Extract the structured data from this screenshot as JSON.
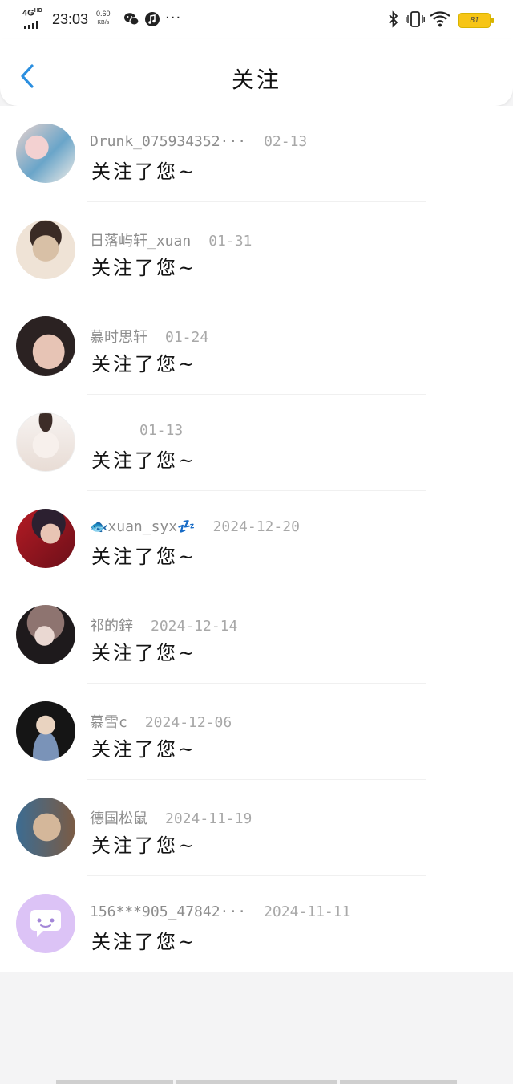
{
  "status_bar": {
    "network": "4G",
    "network_sub": "HD",
    "time": "23:03",
    "speed_value": "0.60",
    "speed_unit": "KB/s",
    "more": "···",
    "battery": "81"
  },
  "header": {
    "title": "关注"
  },
  "notifications": [
    {
      "username": "Drunk_075934352···",
      "date": "02-13",
      "text": "关注了您~",
      "avatar_colors": [
        "#f1d6d3",
        "#6aa5c9",
        "#f3eee8"
      ]
    },
    {
      "username": "日落屿轩_xuan",
      "date": "01-31",
      "text": "关注了您~",
      "avatar_colors": [
        "#efe3d6",
        "#d8c0a6",
        "#3a2b25"
      ]
    },
    {
      "username": "慕时思轩",
      "date": "01-24",
      "text": "关注了您~",
      "avatar_colors": [
        "#2b2222",
        "#d8b3a2",
        "#f0d8cc"
      ]
    },
    {
      "username": "",
      "date": "01-13",
      "text": "关注了您~",
      "avatar_colors": [
        "#f7f3f1",
        "#e8dcd5",
        "#3d2d28"
      ]
    },
    {
      "username": "🐟xuan_syx💤",
      "date": "2024-12-20",
      "text": "关注了您~",
      "avatar_colors": [
        "#b41b24",
        "#2c2030",
        "#e8c4b4"
      ]
    },
    {
      "username": "祁的鋅",
      "date": "2024-12-14",
      "text": "关注了您~",
      "avatar_colors": [
        "#1e1a1c",
        "#8e7470",
        "#ead8d2"
      ]
    },
    {
      "username": "慕雪c",
      "date": "2024-12-06",
      "text": "关注了您~",
      "avatar_colors": [
        "#151515",
        "#e9d3c0",
        "#7a93b8"
      ]
    },
    {
      "username": "德国松鼠",
      "date": "2024-11-19",
      "text": "关注了您~",
      "avatar_colors": [
        "#3c6c92",
        "#d4b79a",
        "#7b5b44"
      ]
    },
    {
      "username": "156***905_47842···",
      "date": "2024-11-11",
      "text": "关注了您~",
      "avatar_colors": [
        "#dcc3f6",
        "#ffffff",
        "#a386d8"
      ]
    }
  ],
  "colors": {
    "accent": "#2b8fe0",
    "text_primary": "#141414",
    "text_secondary": "#8d8d8d"
  }
}
